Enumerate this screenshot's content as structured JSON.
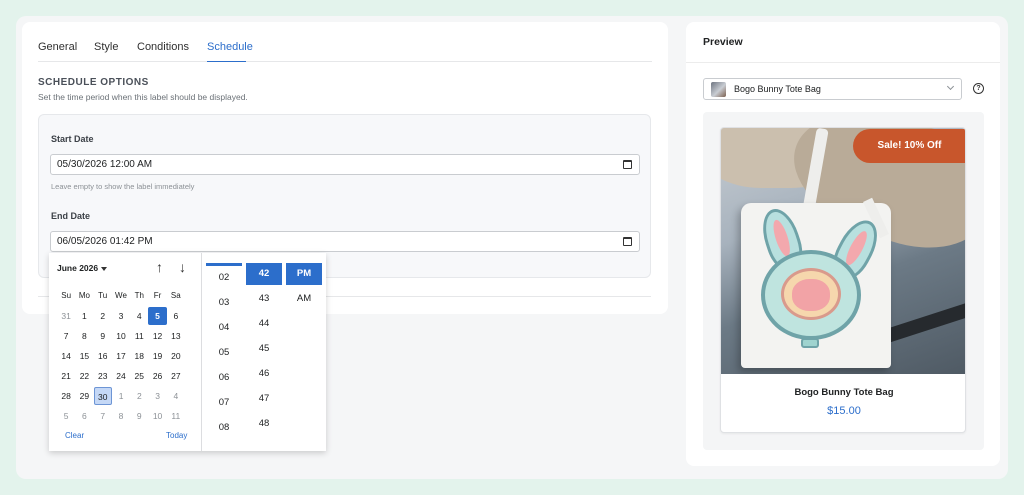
{
  "tabs": [
    {
      "label": "General",
      "active": false
    },
    {
      "label": "Style",
      "active": false
    },
    {
      "label": "Conditions",
      "active": false
    },
    {
      "label": "Schedule",
      "active": true
    }
  ],
  "schedule": {
    "title": "SCHEDULE OPTIONS",
    "description": "Set the time period when this label should be displayed.",
    "start_label": "Start Date",
    "start_value": "05/30/2026 12:00 AM",
    "start_hint": "Leave empty to show the label immediately",
    "end_label": "End Date",
    "end_value": "06/05/2026 01:42 PM"
  },
  "picker": {
    "month": "June 2026",
    "weekdays": [
      "Su",
      "Mo",
      "Tu",
      "We",
      "Th",
      "Fr",
      "Sa"
    ],
    "weeks": [
      [
        "31",
        "1",
        "2",
        "3",
        "4",
        "5",
        "6"
      ],
      [
        "7",
        "8",
        "9",
        "10",
        "11",
        "12",
        "13"
      ],
      [
        "14",
        "15",
        "16",
        "17",
        "18",
        "19",
        "20"
      ],
      [
        "21",
        "22",
        "23",
        "24",
        "25",
        "26",
        "27"
      ],
      [
        "28",
        "29",
        "30",
        "1",
        "2",
        "3",
        "4"
      ],
      [
        "5",
        "6",
        "7",
        "8",
        "9",
        "10",
        "11"
      ]
    ],
    "selected_day": "5",
    "today_day": "30",
    "clear_label": "Clear",
    "today_label": "Today",
    "hours": [
      "02",
      "03",
      "04",
      "05",
      "06",
      "07",
      "08"
    ],
    "minutes": [
      "42",
      "43",
      "44",
      "45",
      "46",
      "47",
      "48"
    ],
    "selected_minute": "42",
    "ampm": [
      "PM",
      "AM"
    ],
    "selected_ampm": "PM"
  },
  "preview": {
    "title": "Preview",
    "product_select": "Bogo Bunny Tote Bag",
    "help_glyph": "?",
    "badge": "Sale! 10% Off",
    "product_name": "Bogo Bunny Tote Bag",
    "product_price": "$15.00"
  },
  "colors": {
    "accent": "#2c6ecb",
    "badge": "#c8562c",
    "background": "#e3f3ec"
  },
  "icons": {
    "calendar": "calendar-icon",
    "nav_up": "arrow-up-icon",
    "nav_down": "arrow-down-icon",
    "select_chevron": "chevron-down-icon",
    "help": "help-circle-icon"
  }
}
